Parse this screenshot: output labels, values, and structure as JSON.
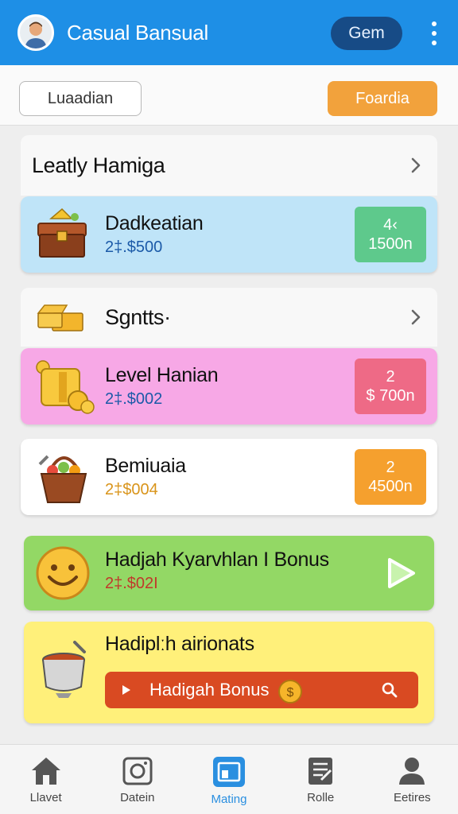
{
  "app": {
    "title": "Casual Bansual",
    "gem_label": "Gem"
  },
  "toolbar": {
    "language_label": "Luaadian",
    "action_label": "Foardia"
  },
  "sections": [
    {
      "title": "Leatly Hamiga"
    },
    {
      "title": "Sgntts·"
    }
  ],
  "cards": [
    {
      "name": "Dadkeatian",
      "sub": "2‡.$500",
      "badge_top": "4‹",
      "badge_bottom": "1500n",
      "color": "#bfe4f8",
      "badge_color": "#5ec98c",
      "sub_color": "#1b5aa8"
    },
    {
      "name": "Level Hanian",
      "sub": "2‡.$002",
      "badge_top": "2",
      "badge_bottom": "$ 700n",
      "color": "#f7a8e6",
      "badge_color": "#ee6a86",
      "sub_color": "#1b5aa8"
    },
    {
      "name": "Bemiuaia",
      "sub": "2‡$004",
      "badge_top": "2",
      "badge_bottom": "4500n",
      "color": "#ffffff",
      "badge_color": "#f5a02e",
      "sub_color": "#d9941a"
    },
    {
      "name": "Hadjah Kyarvhlan I  Bonus",
      "sub": "2‡.$02I",
      "color": "#93d865",
      "sub_color": "#c0392b"
    },
    {
      "name": "Hadiplːh airionats",
      "color": "#fff07a"
    }
  ],
  "promo": {
    "search_label": "Hadigah Bonus"
  },
  "nav": [
    {
      "label": "Llavet",
      "icon": "home-icon"
    },
    {
      "label": "Datein",
      "icon": "camera-icon"
    },
    {
      "label": "Mating",
      "icon": "tablet-icon",
      "active": true
    },
    {
      "label": "Rolle",
      "icon": "document-icon"
    },
    {
      "label": "Eetires",
      "icon": "person-icon"
    }
  ]
}
